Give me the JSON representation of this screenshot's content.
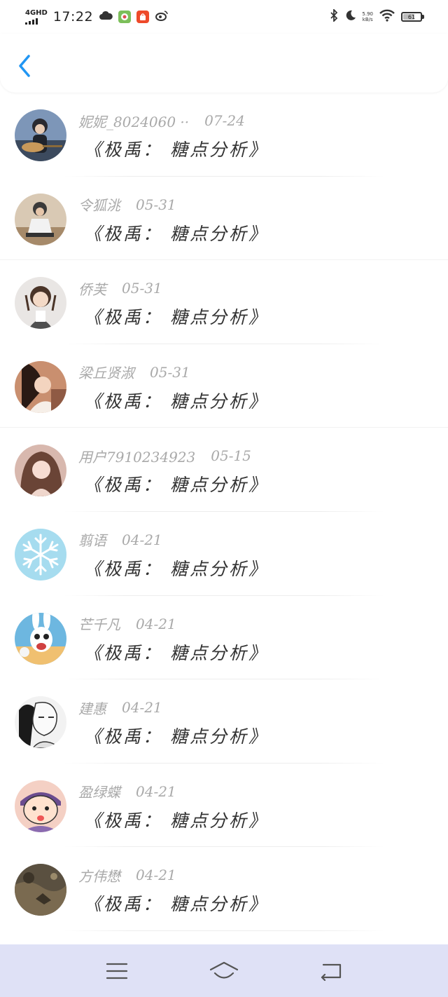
{
  "status_bar": {
    "network": "4GHD",
    "time": "17:22",
    "speed_value": "5.90",
    "speed_unit": "kB/s",
    "battery_level": "61"
  },
  "header": {
    "back_icon": "chevron-left-icon",
    "accent_color": "#2196f3"
  },
  "list": {
    "items": [
      {
        "name": "妮妮_8024060 ··",
        "date": "07-24",
        "message": "《极禹： 糖点分析》"
      },
      {
        "name": "令狐洮",
        "date": "05-31",
        "message": "《极禹： 糖点分析》"
      },
      {
        "name": "侨芙",
        "date": "05-31",
        "message": "《极禹： 糖点分析》"
      },
      {
        "name": "梁丘贤淑",
        "date": "05-31",
        "message": "《极禹： 糖点分析》"
      },
      {
        "name": "用户7910234923",
        "date": "05-15",
        "message": "《极禹： 糖点分析》"
      },
      {
        "name": "翦语",
        "date": "04-21",
        "message": "《极禹： 糖点分析》"
      },
      {
        "name": "芒千凡",
        "date": "04-21",
        "message": "《极禹： 糖点分析》"
      },
      {
        "name": "建惠",
        "date": "04-21",
        "message": "《极禹： 糖点分析》"
      },
      {
        "name": "盈绿蝶",
        "date": "04-21",
        "message": "《极禹： 糖点分析》"
      },
      {
        "name": "方伟懋",
        "date": "04-21",
        "message": "《极禹： 糖点分析》"
      }
    ]
  },
  "nav_bar": {
    "menu_icon": "menu-icon",
    "home_icon": "home-icon",
    "back_icon": "back-icon"
  }
}
